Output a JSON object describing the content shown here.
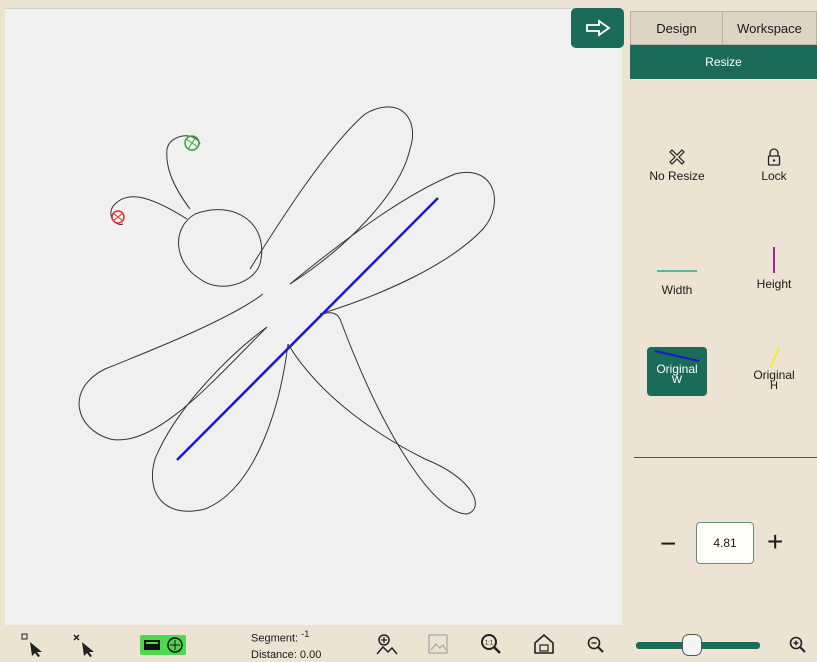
{
  "header": {
    "arrow_icon": "arrow-right-icon"
  },
  "tabs": [
    {
      "label": "Design"
    },
    {
      "label": "Workspace"
    }
  ],
  "resize_bar": {
    "label": "Resize"
  },
  "options": {
    "no_resize": {
      "label": "No Resize",
      "icon": "x-icon"
    },
    "lock": {
      "label": "Lock",
      "icon": "lock-icon"
    },
    "width": {
      "label": "Width"
    },
    "height": {
      "label": "Height"
    },
    "original_w": {
      "label": "Original",
      "sub": "W"
    },
    "original_h": {
      "label": "Original",
      "sub": "H"
    }
  },
  "stepper": {
    "minus": "−",
    "value": "4.81",
    "plus": "+"
  },
  "status": {
    "segment_label": "Segment:",
    "segment_value": "-1",
    "distance_label": "Distance:",
    "distance_value": "0.00"
  },
  "colors": {
    "accent": "#1b6b5a",
    "measure_line": "#1a1acc",
    "start_marker": "#3aa63a",
    "end_marker": "#e03030"
  }
}
